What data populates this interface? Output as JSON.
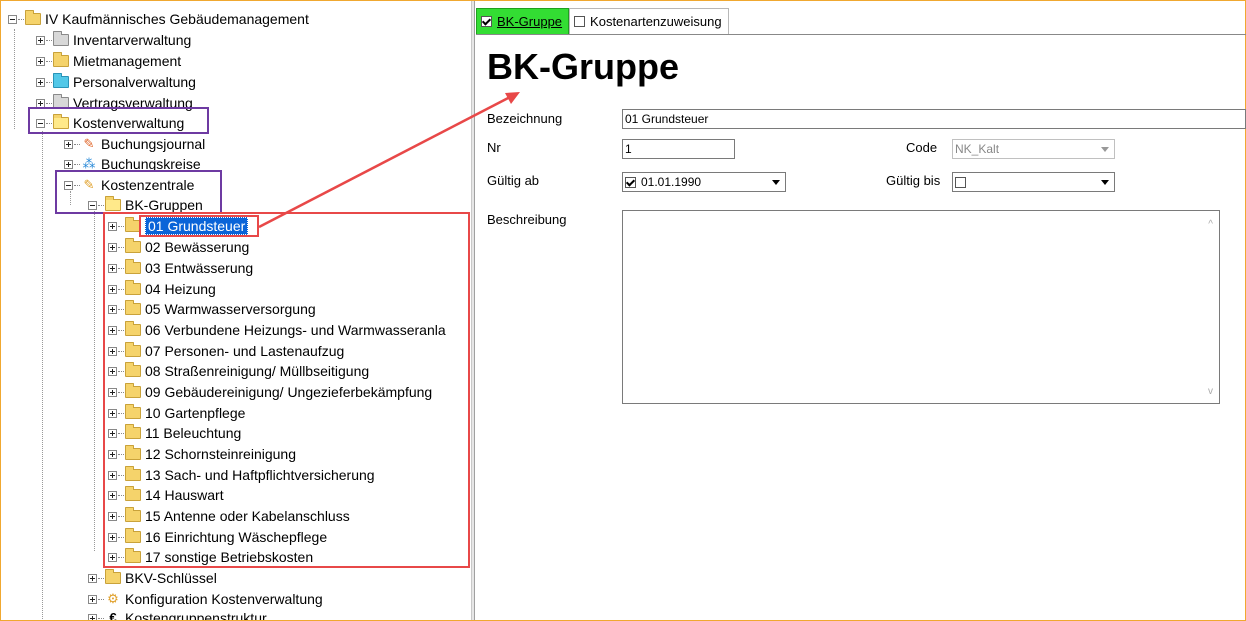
{
  "tree": {
    "items": [
      {
        "label": "IV Kaufmännisches Gebäudemanagement",
        "icon": "folder-icon"
      },
      {
        "label": "Inventarverwaltung",
        "icon": "grey-folder-icon"
      },
      {
        "label": "Mietmanagement",
        "icon": "folder-icon"
      },
      {
        "label": "Personalverwaltung",
        "icon": "cyan-folder-icon"
      },
      {
        "label": "Vertragsverwaltung",
        "icon": "folder-icon"
      },
      {
        "label": "Kostenverwaltung",
        "icon": "open-folder-icon"
      },
      {
        "label": "Buchungsjournal",
        "icon": "journal-icon"
      },
      {
        "label": "Buchungskreise",
        "icon": "network-icon"
      },
      {
        "label": "Kostenzentrale",
        "icon": "cost-center-icon"
      },
      {
        "label": "BK-Gruppen",
        "icon": "open-folder-icon"
      },
      {
        "label": "BKV-Schlüssel",
        "icon": "folder-icon"
      },
      {
        "label": "Konfiguration Kostenverwaltung",
        "icon": "config-icon"
      },
      {
        "label": "Kostengruppenstruktur",
        "icon": "structure-icon"
      }
    ],
    "groups": [
      "01 Grundsteuer",
      "02 Bewässerung",
      "03 Entwässerung",
      "04 Heizung",
      "05 Warmwasserversorgung",
      "06 Verbundene Heizungs- und Warmwasseranla",
      "07 Personen- und Lastenaufzug",
      "08 Straßenreinigung/ Müllbseitigung",
      "09 Gebäudereinigung/ Ungezieferbekämpfung",
      "10 Gartenpflege",
      "11 Beleuchtung",
      "12 Schornsteinreinigung",
      "13 Sach- und Haftpflichtversicherung",
      "14 Hauswart",
      "15 Antenne oder Kabelanschluss",
      "16 Einrichtung Wäschepflege",
      "17 sonstige Betriebskosten"
    ],
    "selected": "01 Grundsteuer"
  },
  "tabs": [
    {
      "label": "BK-Gruppe",
      "checked": true,
      "active": true
    },
    {
      "label": "Kostenartenzuweisung",
      "checked": false,
      "active": false
    }
  ],
  "form": {
    "title": "BK-Gruppe",
    "bezeichnung_label": "Bezeichnung",
    "bezeichnung_value": "01 Grundsteuer",
    "nr_label": "Nr",
    "nr_value": "1",
    "code_label": "Code",
    "code_value": "NK_Kalt",
    "gueltig_ab_label": "Gültig ab",
    "gueltig_ab_value": "01.01.1990",
    "gueltig_bis_label": "Gültig bis",
    "gueltig_bis_value": "",
    "beschreibung_label": "Beschreibung"
  },
  "colors": {
    "accent_purple": "#6e3aa2",
    "accent_red": "#e84848",
    "active_tab": "#33dd33",
    "selection": "#0a64d8"
  }
}
